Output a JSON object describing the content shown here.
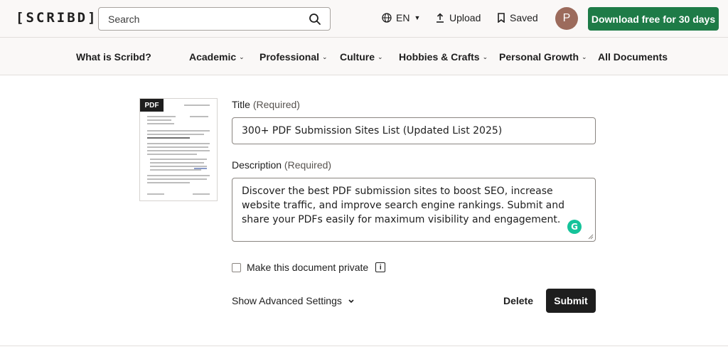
{
  "header": {
    "logo": "[SCRIBD]",
    "search_placeholder": "Search",
    "language": "EN",
    "upload_label": "Upload",
    "saved_label": "Saved",
    "avatar_initial": "P",
    "cta_label": "Download free for 30 days"
  },
  "categories": [
    {
      "label": "What is Scribd?",
      "dropdown": false
    },
    {
      "label": "Academic",
      "dropdown": true
    },
    {
      "label": "Professional",
      "dropdown": true
    },
    {
      "label": "Culture",
      "dropdown": true
    },
    {
      "label": "Hobbies & Crafts",
      "dropdown": true
    },
    {
      "label": "Personal Growth",
      "dropdown": true
    },
    {
      "label": "All Documents",
      "dropdown": false
    }
  ],
  "document": {
    "badge": "PDF"
  },
  "form": {
    "title_label": "Title",
    "title_required": "(Required)",
    "title_value": "300+  PDF Submission Sites List (Updated List 2025)",
    "description_label": "Description",
    "description_required": "(Required)",
    "description_value": "Discover the best PDF submission sites to boost SEO, increase website traffic, and improve search engine rankings. Submit and share your PDFs easily for maximum visibility and engagement.",
    "private_label": "Make this document private",
    "private_checked": false,
    "advanced_label": "Show Advanced Settings",
    "delete_label": "Delete",
    "submit_label": "Submit"
  },
  "colors": {
    "brand_green": "#1e7b47",
    "dark": "#1e1e1e",
    "grammarly": "#15c39a",
    "avatar": "#9c6b5c"
  }
}
